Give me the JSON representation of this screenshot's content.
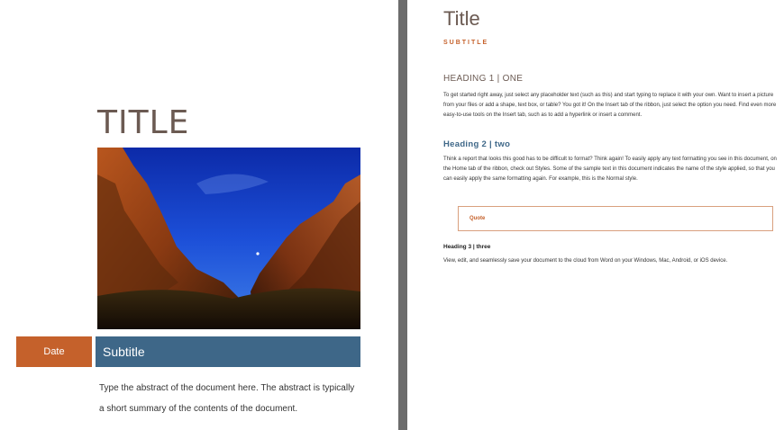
{
  "cover": {
    "title": "TITLE",
    "date_label": "Date",
    "subtitle": "Subtitle",
    "abstract": "Type the abstract of the document here. The abstract is typically a short summary of the contents of the document."
  },
  "document": {
    "title": "Title",
    "subtitle": "SUBTITLE",
    "heading1": "HEADING 1 | ONE",
    "paragraph1": "To get started right away, just select any placeholder text (such as this) and start typing to replace it with your own. Want to insert a picture from your files or add a shape, text box, or table? You got it! On the Insert tab of the ribbon, just select the option you need. Find even more easy-to-use tools on the Insert tab, such as to add a hyperlink or insert a comment.",
    "heading2": "Heading 2 | two",
    "paragraph2": "Think a report that looks this good has to be difficult to format? Think again! To easily apply any text formatting you see in this document, on the Home tab of the ribbon, check out Styles. Some of the sample text in this document indicates the name of the style applied, so that you can easily apply the same formatting again. For example, this is the Normal style.",
    "quote": "Quote",
    "heading3": "Heading 3 | three",
    "paragraph3": "View, edit, and seamlessly save your document to the cloud from Word on your Windows, Mac, Android, or iOS device."
  },
  "colors": {
    "accent_orange": "#c5612b",
    "accent_blue": "#3e6788",
    "title_brown": "#6b5a52",
    "divider_gray": "#6c6c6c"
  }
}
